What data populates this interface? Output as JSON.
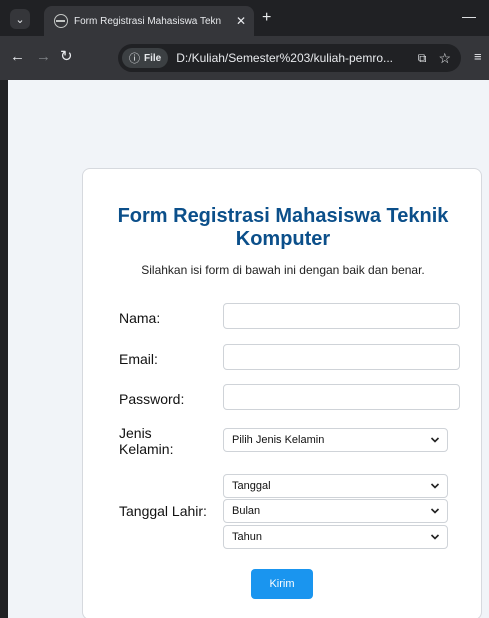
{
  "browser": {
    "tab_title": "Form Registrasi Mahasiswa Tekn",
    "new_tab_symbol": "+",
    "file_chip_label": "File",
    "url": "D:/Kuliah/Semester%203/kuliah-pemro..."
  },
  "form": {
    "title": "Form Registrasi Mahasiswa Teknik Komputer",
    "subtitle": "Silahkan isi form di bawah ini dengan baik dan benar.",
    "fields": {
      "nama_label": "Nama:",
      "email_label": "Email:",
      "password_label": "Password:",
      "gender_label": "Jenis Kelamin:",
      "gender_selected": "Pilih Jenis Kelamin",
      "birth_label": "Tanggal Lahir:",
      "day_selected": "Tanggal",
      "month_selected": "Bulan",
      "year_selected": "Tahun"
    },
    "submit_label": "Kirim"
  },
  "colors": {
    "title": "#0b4f8a",
    "submit_button": "#1a95ef",
    "chrome_dark": "#202124"
  }
}
